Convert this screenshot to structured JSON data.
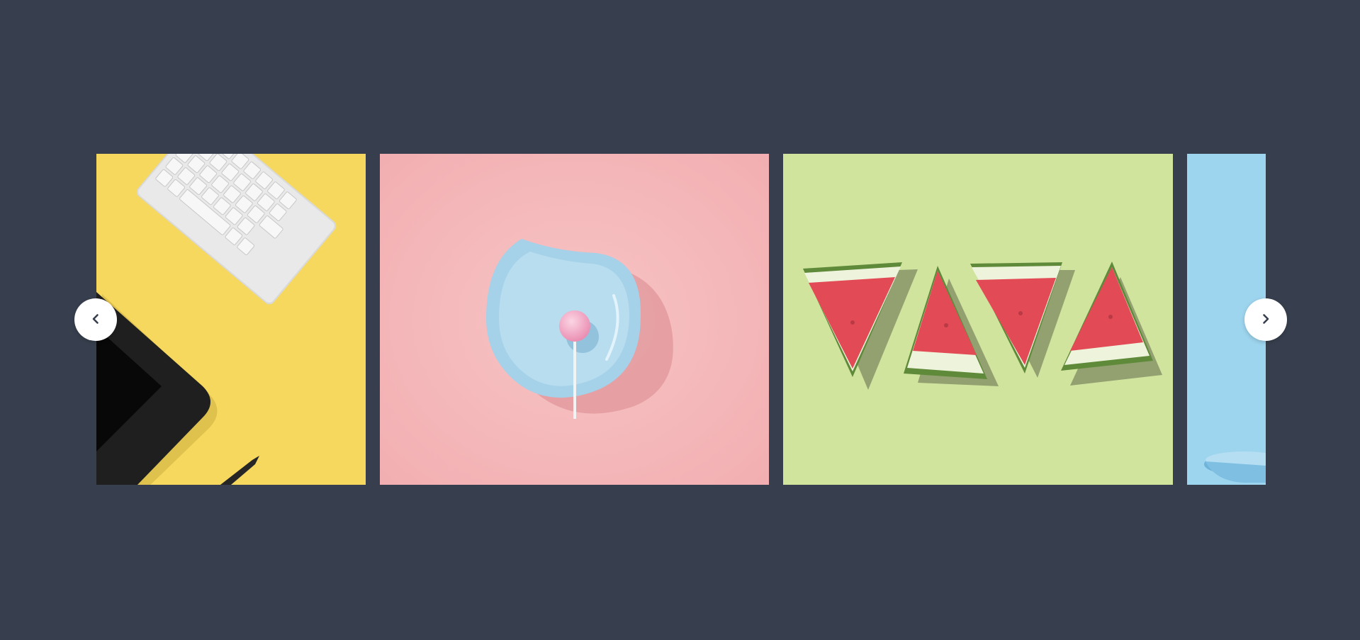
{
  "carousel": {
    "background": "#373f4e",
    "slides": [
      {
        "subject": "keyboard-and-tablet-on-yellow",
        "bg": "#f6d85e"
      },
      {
        "subject": "lollipop-on-blue-plate-on-pink",
        "bg": "#f5bcbd"
      },
      {
        "subject": "watermelon-slices-on-green",
        "bg": "#d0e49e"
      },
      {
        "subject": "blue-bowl-on-light-blue",
        "bg": "#9dd4ee"
      }
    ],
    "prev_icon": "chevron-left-icon",
    "next_icon": "chevron-right-icon"
  }
}
